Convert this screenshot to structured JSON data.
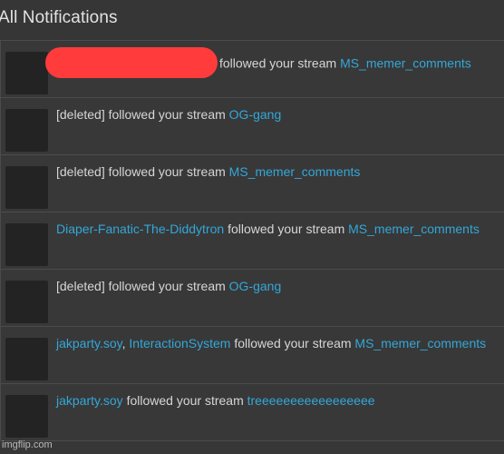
{
  "header": {
    "title": "All Notifications"
  },
  "notifications": [
    {
      "actor_text": "",
      "actor_redacted": true,
      "action": "followed your stream",
      "stream": "MS_memer_comments"
    },
    {
      "actor_text": "[deleted]",
      "action": "followed your stream",
      "stream": "OG-gang"
    },
    {
      "actor_text": "[deleted]",
      "action": "followed your stream",
      "stream": "MS_memer_comments"
    },
    {
      "actor_link": "Diaper-Fanatic-The-Diddytron",
      "action": "followed your stream",
      "stream": "MS_memer_comments"
    },
    {
      "actor_text": "[deleted]",
      "action": "followed your stream",
      "stream": "OG-gang"
    },
    {
      "actor_link": "jakparty.soy",
      "separator": ",",
      "actor_link_2": "InteractionSystem",
      "action": "followed your stream",
      "stream": "MS_memer_comments"
    },
    {
      "actor_link": "jakparty.soy",
      "action": "followed your stream",
      "stream": "treeeeeeeeeeeeeeeee"
    }
  ],
  "watermark": "imgflip.com",
  "colors": {
    "background": "#373737",
    "link": "#33a7d8",
    "redaction": "#ff3b3b",
    "avatar": "#232323"
  }
}
